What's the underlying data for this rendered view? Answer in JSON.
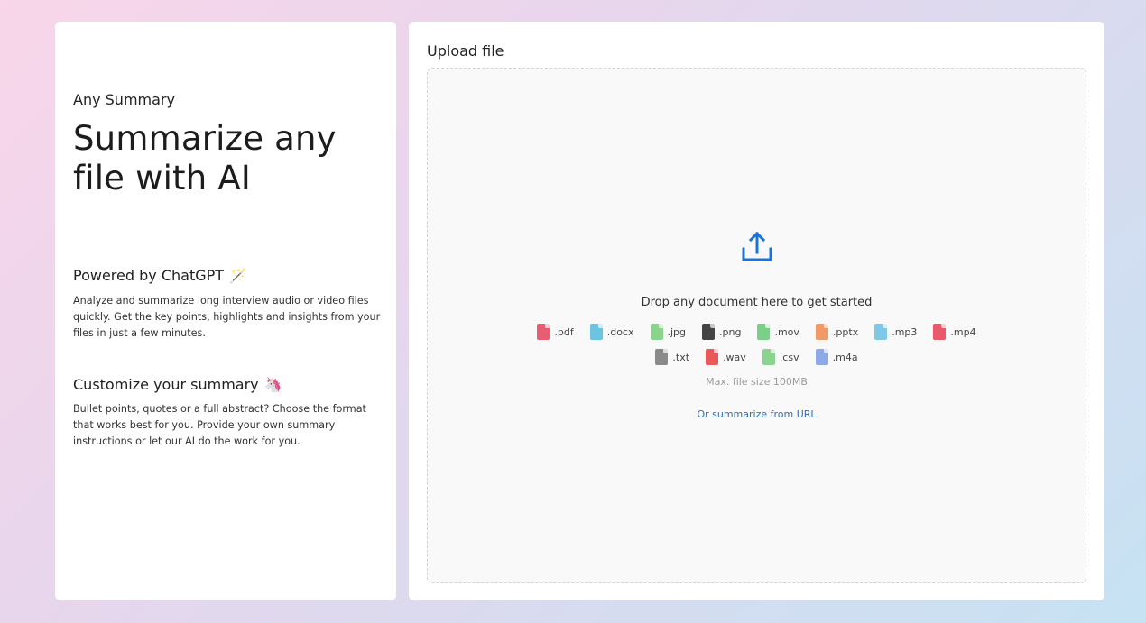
{
  "left": {
    "brand": "Any Summary",
    "headline": "Summarize any file with AI",
    "features": [
      {
        "title": "Powered by ChatGPT",
        "emoji": "🪄",
        "text": "Analyze and summarize long interview audio or video files quickly. Get the key points, highlights and insights from your files in just a few minutes."
      },
      {
        "title": "Customize your summary",
        "emoji": "🦄",
        "text": "Bullet points, quotes or a full abstract? Choose the format that works best for you. Provide your own summary instructions or let our AI do the work for you."
      }
    ]
  },
  "upload": {
    "title": "Upload file",
    "drop_text": "Drop any document here to get started",
    "upload_icon": "upload-icon",
    "types_row1": [
      {
        "ext": ".pdf",
        "color": "#e85d6f"
      },
      {
        "ext": ".docx",
        "color": "#6cc4e0"
      },
      {
        "ext": ".jpg",
        "color": "#8ad48e"
      },
      {
        "ext": ".png",
        "color": "#444444"
      },
      {
        "ext": ".mov",
        "color": "#7ccf88"
      },
      {
        "ext": ".pptx",
        "color": "#f09a6a"
      },
      {
        "ext": ".mp3",
        "color": "#7ec8e8"
      },
      {
        "ext": ".mp4",
        "color": "#e8596c"
      }
    ],
    "types_row2": [
      {
        "ext": ".txt",
        "color": "#8a8a8a"
      },
      {
        "ext": ".wav",
        "color": "#e85a5a"
      },
      {
        "ext": ".csv",
        "color": "#8ad48e"
      },
      {
        "ext": ".m4a",
        "color": "#8fa8e8"
      }
    ],
    "max_size": "Max. file size 100MB",
    "url_link": "Or summarize from URL",
    "accent": "#1a73d9"
  }
}
